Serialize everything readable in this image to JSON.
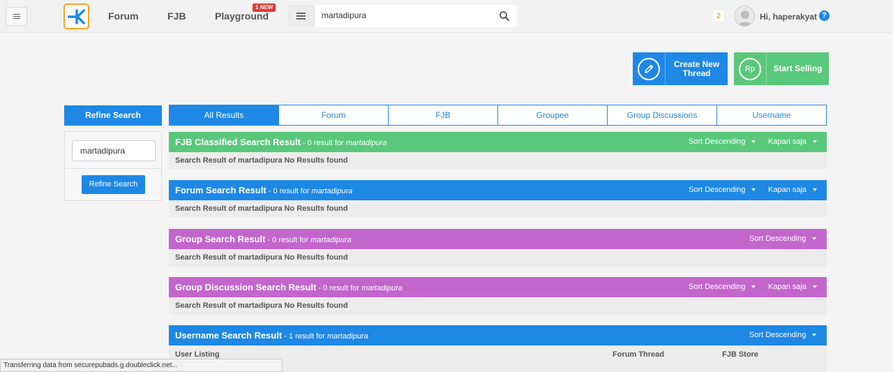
{
  "topbar": {
    "nav": {
      "forum": "Forum",
      "fjb": "FJB",
      "playground": "Playground",
      "playground_badge": "1 NEW"
    },
    "search": {
      "value": "martadipura"
    },
    "notification_count": "2",
    "greeting": "Hi, haperakyat",
    "help": "?"
  },
  "actions": {
    "create": "Create New Thread",
    "sell": "Start Selling",
    "sell_icon_text": "Rp"
  },
  "refine": {
    "title": "Refine Search",
    "input_value": "martadipura",
    "button": "Refine Search"
  },
  "tabs": [
    "All Results",
    "Forum",
    "FJB",
    "Groupee",
    "Group Discussions",
    "Username"
  ],
  "sections": [
    {
      "title": "FJB Classified Search Result",
      "count": " - 0 result for ",
      "keyword": "martadipura",
      "sort": "Sort Descending",
      "time": "Kapan saja",
      "body": "Search Result of martadipura No Results found"
    },
    {
      "title": "Forum Search Result",
      "count": " - 0 result for ",
      "keyword": "martadipura",
      "sort": "Sort Descending",
      "time": "Kapan saja",
      "body": "Search Result of martadipura No Results found"
    },
    {
      "title": "Group Search Result",
      "count": " - 0 result for ",
      "keyword": "martadipura",
      "sort": "Sort Descending",
      "body": "Search Result of martadipura No Results found"
    },
    {
      "title": "Group Discussion Search Result",
      "count": " - 0 result for ",
      "keyword": "martadipura",
      "sort": "Sort Descending",
      "time": "Kapan saja",
      "body": "Search Result of martadipura No Results found"
    },
    {
      "title": "Username Search Result",
      "count": " - 1 result for ",
      "keyword": "martadipura",
      "sort": "Sort Descending",
      "columns": [
        "User Listing",
        "Forum Thread",
        "FJB Store"
      ]
    }
  ],
  "status_text": "Transferring data from securepubads.g.doubleclick.net...",
  "colors": {
    "blue": "#1e88e5",
    "green": "#59c87b",
    "purple": "#c266cc",
    "orange": "#f5a623"
  }
}
